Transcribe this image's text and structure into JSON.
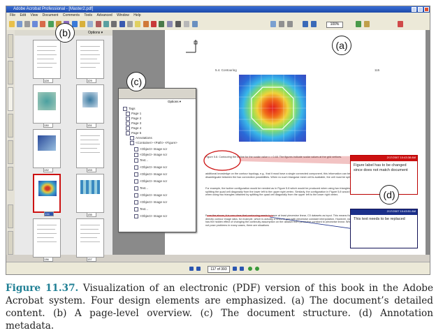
{
  "window": {
    "title": "Adobe Acrobat Professional - [Master2.pdf]",
    "menu": [
      "File",
      "Edit",
      "View",
      "Document",
      "Comments",
      "Tools",
      "Advanced",
      "Window",
      "Help"
    ],
    "zoom": "100%"
  },
  "thumbnails": {
    "options_label": "Options ▾",
    "page_labels": [
      "128",
      "129",
      "130",
      "131",
      "132",
      "133",
      "134",
      "135",
      "136",
      "137"
    ]
  },
  "tree_panel": {
    "options_label": "Options ▾",
    "items": [
      "Tags",
      "Page 1",
      "Page 2",
      "Page 3",
      "Page 4",
      "Page 5",
      "Annotations",
      "<Container> <Path> <Figure>",
      "<Object> Image scr",
      "<Object> Image scr",
      "Text...",
      "<Object> Image scr",
      "<Object> Image scr",
      "<Object> Image scr",
      "Text...",
      "<Object> Image scr",
      "<Object> Image scr",
      "Text...",
      "<Object> Image scr"
    ]
  },
  "document_page": {
    "running_head": "5.4. Contouring",
    "page_number": "115",
    "figure_caption": "Figure 5.8. Contouring the isoline for the scalar value v = 0.48. The figures indicate scalar values at the grid vertices.",
    "body_text": [
      "additional knowledge on the contour topology, e.g., that it must have a single connected component, this information can be used to disambiguate between the two connection possibilities. When no such triangular mesh cell is available, the cell must be split in two.",
      "For example, the isoline configuration would be needed as in Figure 5.8 which would be produced when using two triangles obtained by splitting the quad cell diagonally from the lower left to the upper right vertex. Similarly, the configuration in Figure 5.8 would be produced when using two triangles obtained by splitting the quad cell diagonally from the upper left to the lower right vertex.",
      "From the above, it is now clear that contouring needs to have at least piecewise linear, C0 datasets as input. This means that we cannot directly contour image data, for example, which is actually a uniform grid with piecewise constant interpolation. However, note that this has the hidden effect of changing the continuity assumption on the dataset from piecewise constant to piecewise linear. While this should not pose problems in many cases, there are situations"
    ]
  },
  "annotations": [
    {
      "header": "Figure",
      "date": "2/17/2007 10:43:38 AM",
      "text": "Figure label has to be changed since does not match document"
    },
    {
      "header": "Cross-Out",
      "date": "2/17/2007 10:43:51 AM",
      "text": "This text needs to be replaced"
    }
  ],
  "statusbar": {
    "page_field": "117 of 393"
  },
  "callouts": {
    "a": "(a)",
    "b": "(b)",
    "c": "(c)",
    "d": "(d)"
  },
  "caption": {
    "label": "Figure 11.37.",
    "text": "Visualization of an electronic (PDF) version of this book in the Adobe Acrobat system. Four design elements are emphasized. (a) The document’s detailed content. (b) A page-level overview. (c) The document structure. (d) Annotation metadata."
  },
  "colors": {
    "highlight_red": "#cc1111",
    "annotation_blue": "#1a2f8a",
    "caption_label": "#1f7f94"
  }
}
